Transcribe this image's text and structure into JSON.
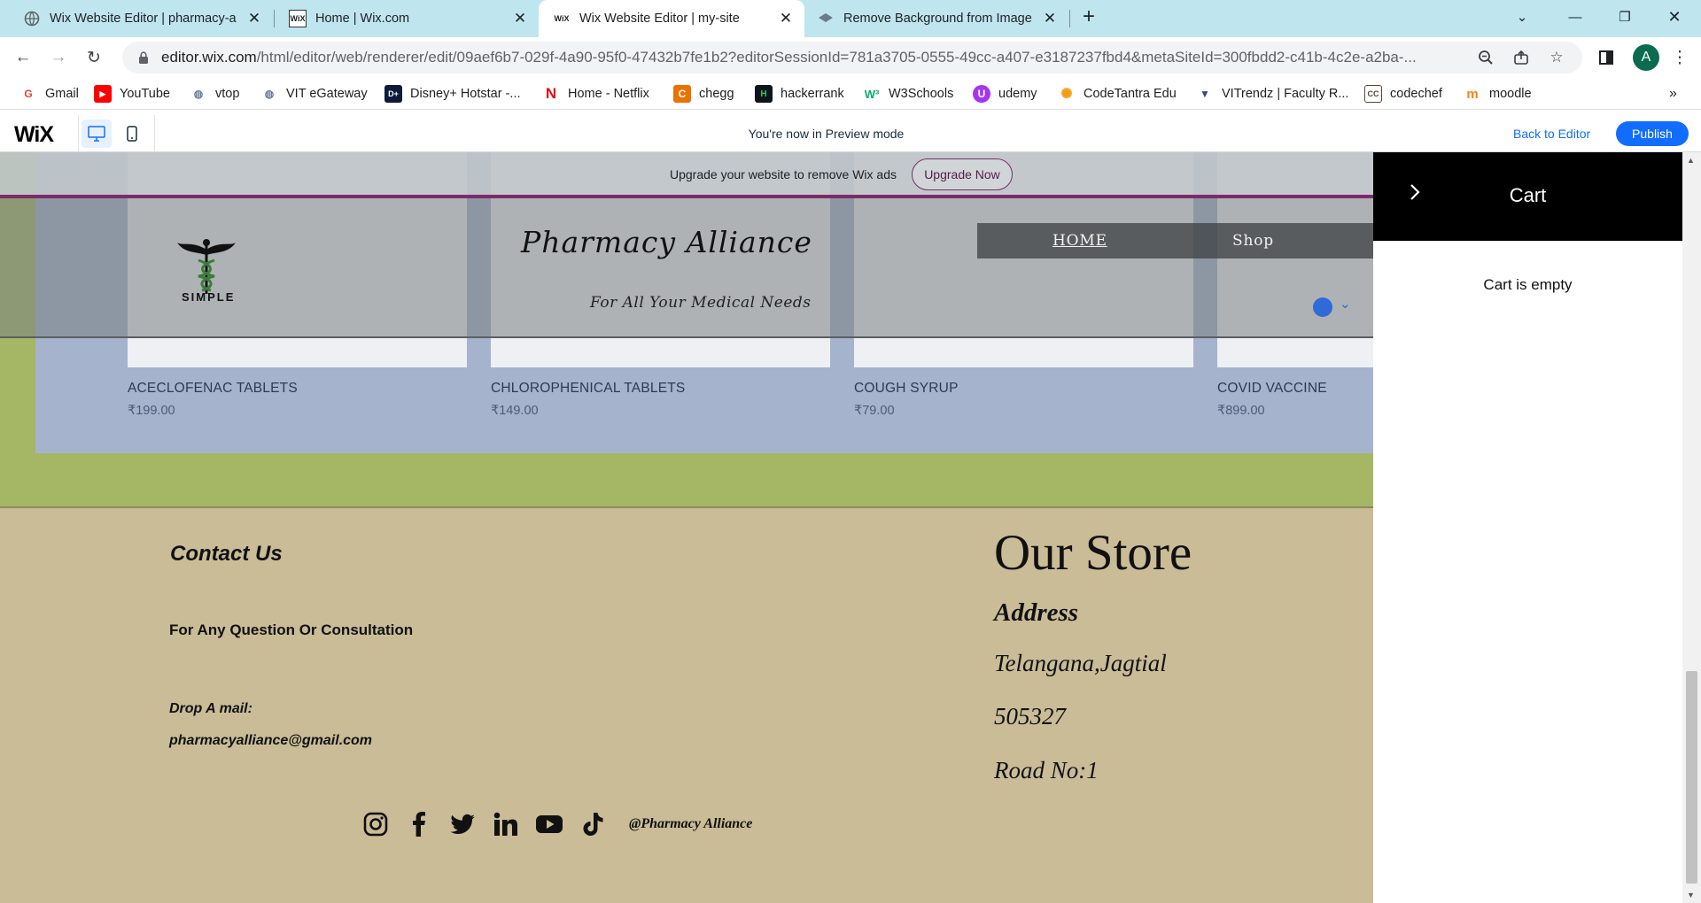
{
  "browser": {
    "tabs": [
      {
        "title": "Wix Website Editor | pharmacy-a",
        "active": false
      },
      {
        "title": "Home | Wix.com",
        "active": false
      },
      {
        "title": "Wix Website Editor | my-site",
        "active": true
      },
      {
        "title": "Remove Background from Image",
        "active": false
      }
    ],
    "new_tab": "+",
    "url_host": "editor.wix.com",
    "url_rest": "/html/editor/web/renderer/edit/09aef6b7-029f-4a90-95f0-47432b7fe1b2?editorSessionId=781a3705-0555-49cc-a407-e3187237fbd4&metaSiteId=300fbdd2-c41b-4c2e-a2ba-...",
    "profile_initial": "A",
    "bookmarks": [
      "Gmail",
      "YouTube",
      "vtop",
      "VIT eGateway",
      "Disney+ Hotstar -...",
      "Home - Netflix",
      "chegg",
      "hackerrank",
      "W3Schools",
      "udemy",
      "CodeTantra Edu",
      "VITrendz | Faculty R...",
      "codechef",
      "moodle"
    ],
    "bookmarks_more": "»"
  },
  "wix_bar": {
    "logo": "WiX",
    "preview_message": "You're now in Preview mode",
    "back_to_editor": "Back to Editor",
    "publish": "Publish"
  },
  "site": {
    "upgrade_message": "Upgrade your website to remove Wix ads",
    "upgrade_button": "Upgrade Now",
    "logo_text": "SIMPLE",
    "title": "Pharmacy Alliance",
    "tagline": "For All Your Medical Needs",
    "nav": [
      {
        "label": "HOME"
      },
      {
        "label": "Shop"
      }
    ],
    "products": [
      {
        "name": "ACECLOFENAC TABLETS",
        "price": "₹199.00"
      },
      {
        "name": "CHLOROPHENICAL TABLETS",
        "price": "₹149.00"
      },
      {
        "name": "COUGH SYRUP",
        "price": "₹79.00"
      },
      {
        "name": "COVID VACCINE",
        "price": "₹899.00"
      }
    ],
    "footer": {
      "contact_title": "Contact Us",
      "consult_text": "For Any Question Or Consultation",
      "mail_label": "Drop A mail:",
      "mail": "pharmacyalliance@gmail.com",
      "store_title": "Our Store",
      "address_label": "Address",
      "address_lines": [
        "Telangana,Jagtial",
        "505327",
        "Road No:1"
      ],
      "social_icons": [
        "instagram-icon",
        "facebook-icon",
        "twitter-icon",
        "linkedin-icon",
        "youtube-icon",
        "tiktok-icon"
      ],
      "handle": "@Pharmacy Alliance"
    }
  },
  "cart": {
    "title": "Cart",
    "empty_message": "Cart is empty"
  },
  "colors": {
    "tabbar": "#bfe6ef",
    "wix_blue": "#116dff",
    "site_green": "#a5b764",
    "product_strip": "#a5b3cc",
    "footer": "#c9bc97",
    "accent_purple": "#7c2b6a"
  }
}
